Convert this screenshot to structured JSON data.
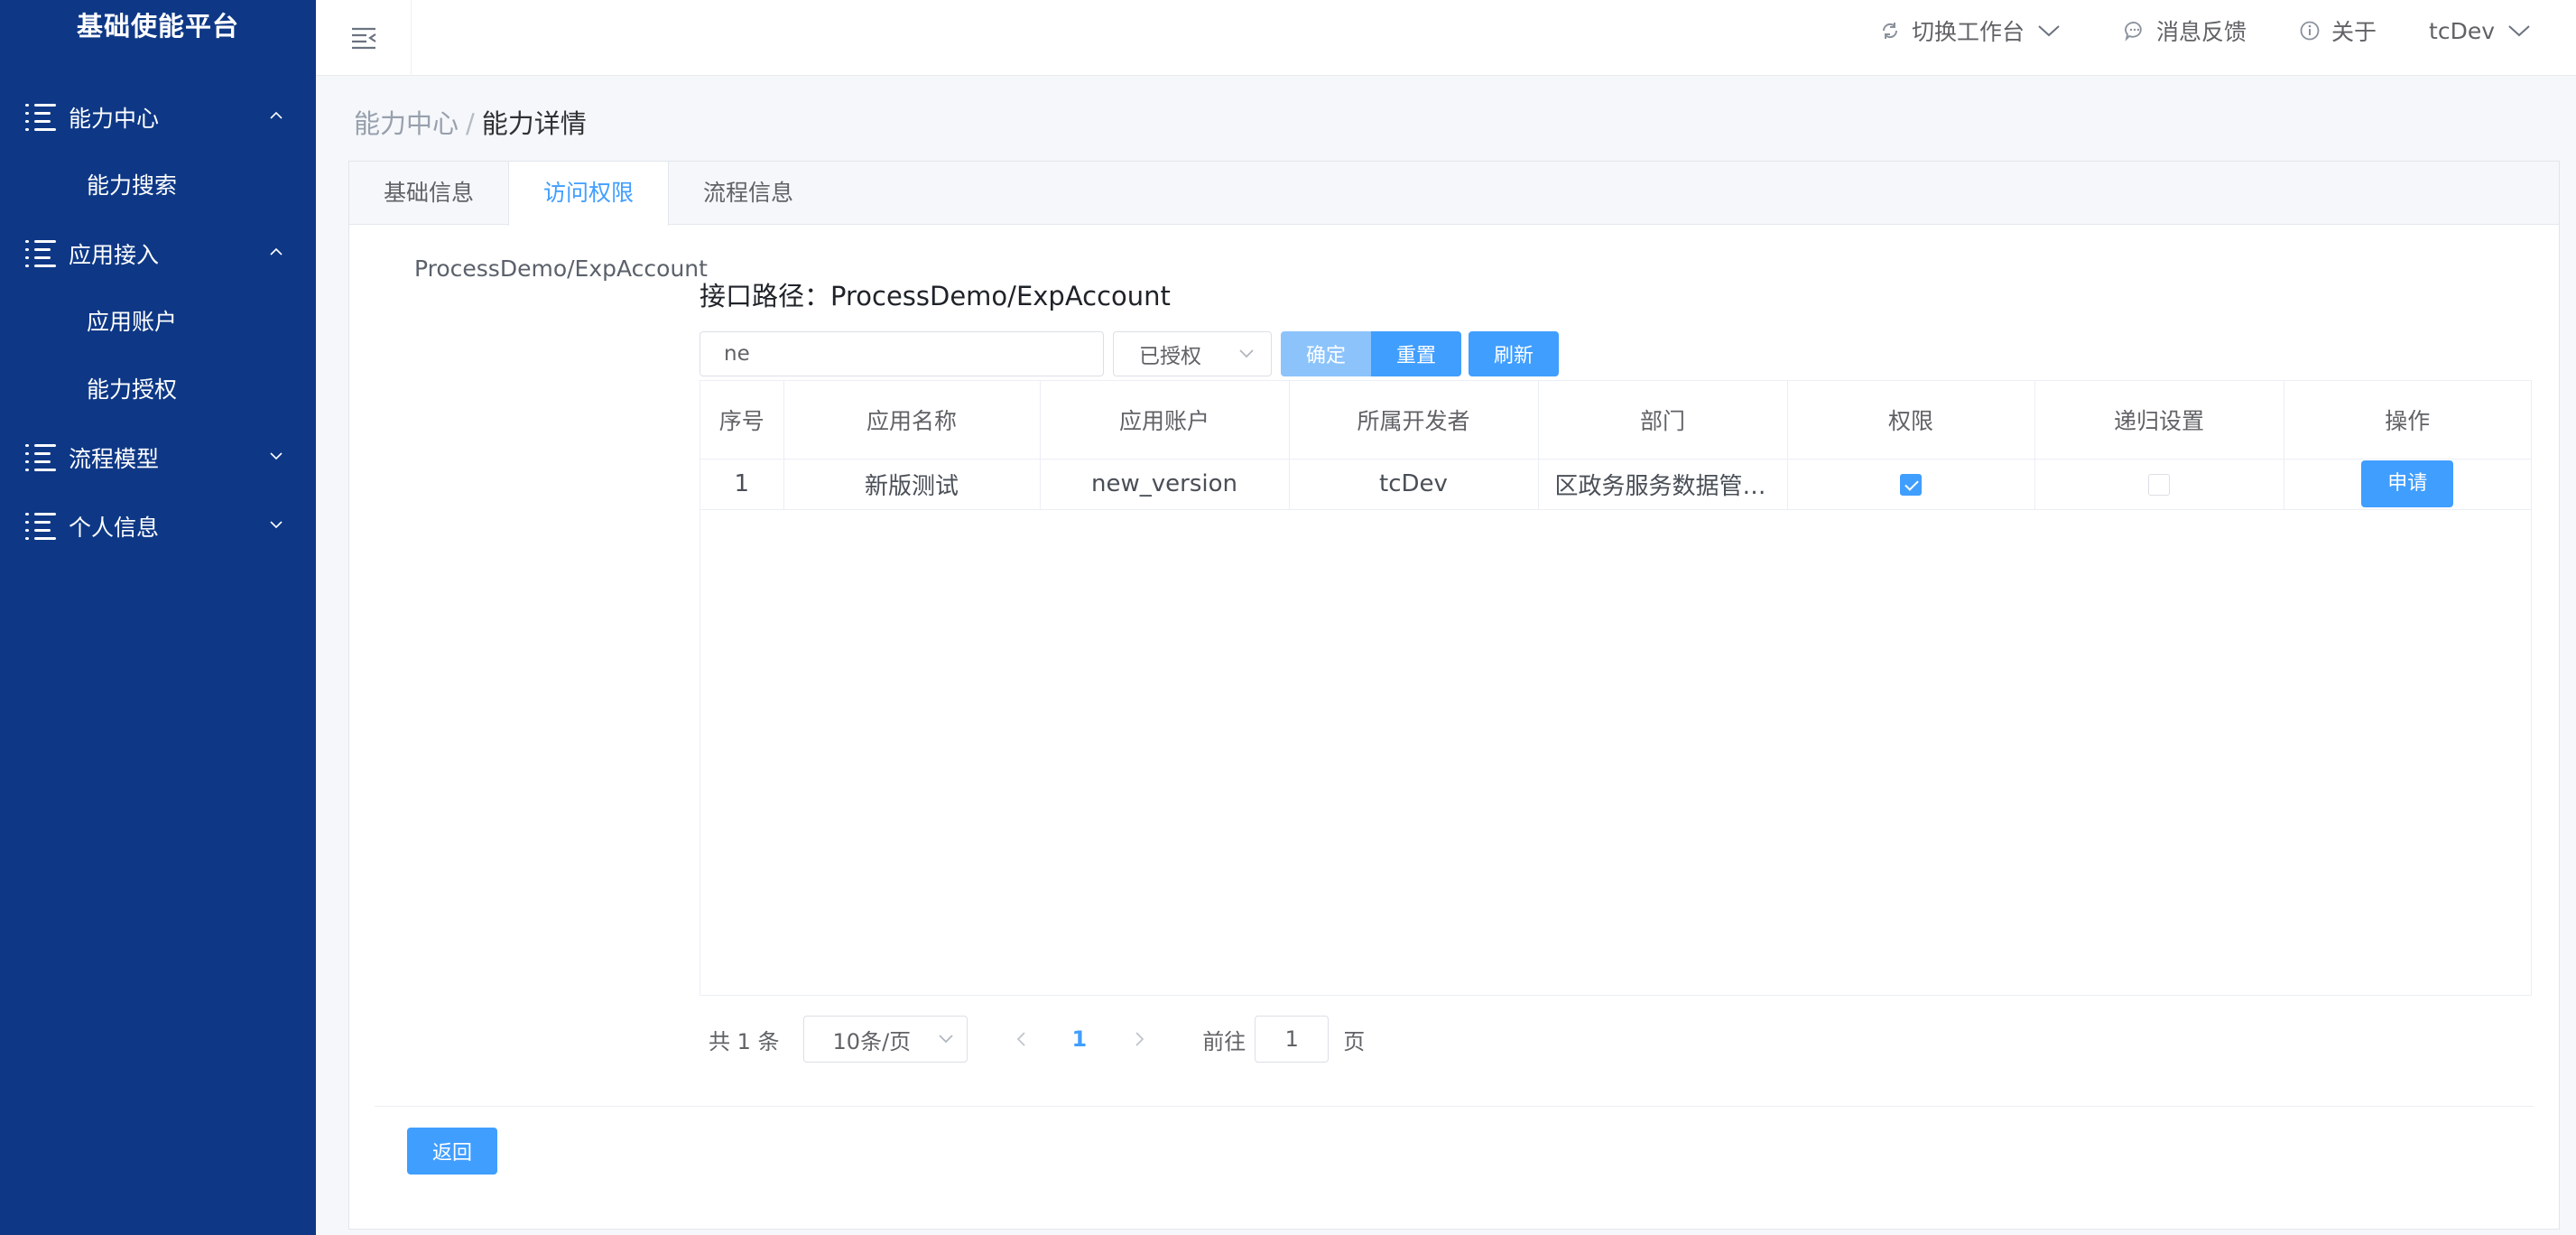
{
  "app": {
    "title": "基础使能平台"
  },
  "sidebar": {
    "groups": [
      {
        "label": "能力中心",
        "expanded": true,
        "items": [
          "能力搜索"
        ]
      },
      {
        "label": "应用接入",
        "expanded": true,
        "items": [
          "应用账户",
          "能力授权"
        ]
      },
      {
        "label": "流程模型",
        "expanded": false,
        "items": []
      },
      {
        "label": "个人信息",
        "expanded": false,
        "items": []
      }
    ]
  },
  "topbar": {
    "switch_workspace": "切换工作台",
    "feedback": "消息反馈",
    "about": "关于",
    "user": "tcDev"
  },
  "breadcrumb": {
    "parent": "能力中心",
    "separator": "/",
    "current": "能力详情"
  },
  "tabs": [
    {
      "label": "基础信息",
      "active": false
    },
    {
      "label": "访问权限",
      "active": true
    },
    {
      "label": "流程信息",
      "active": false
    }
  ],
  "left_path": "ProcessDemo/ExpAccount",
  "api_path": "接口路径：ProcessDemo/ExpAccount",
  "filter": {
    "search_value": "ne",
    "status_selected": "已授权",
    "confirm_label": "确定",
    "reset_label": "重置",
    "refresh_label": "刷新"
  },
  "table": {
    "columns": [
      "序号",
      "应用名称",
      "应用账户",
      "所属开发者",
      "部门",
      "权限",
      "递归设置",
      "操作"
    ],
    "rows": [
      {
        "index": "1",
        "app_name": "新版测试",
        "account": "new_version",
        "developer": "tcDev",
        "department": "区政务服务数据管理局",
        "permission": true,
        "recursive": false,
        "action": "申请"
      }
    ]
  },
  "pagination": {
    "total_text": "共 1 条",
    "page_size": "10条/页",
    "current_page": "1",
    "goto_prefix": "前往",
    "goto_value": "1",
    "goto_suffix": "页"
  },
  "footer": {
    "back_label": "返回"
  },
  "colors": {
    "sidebar_bg": "#0e3886",
    "primary": "#409eff",
    "primary_light": "#8cc3fb"
  }
}
